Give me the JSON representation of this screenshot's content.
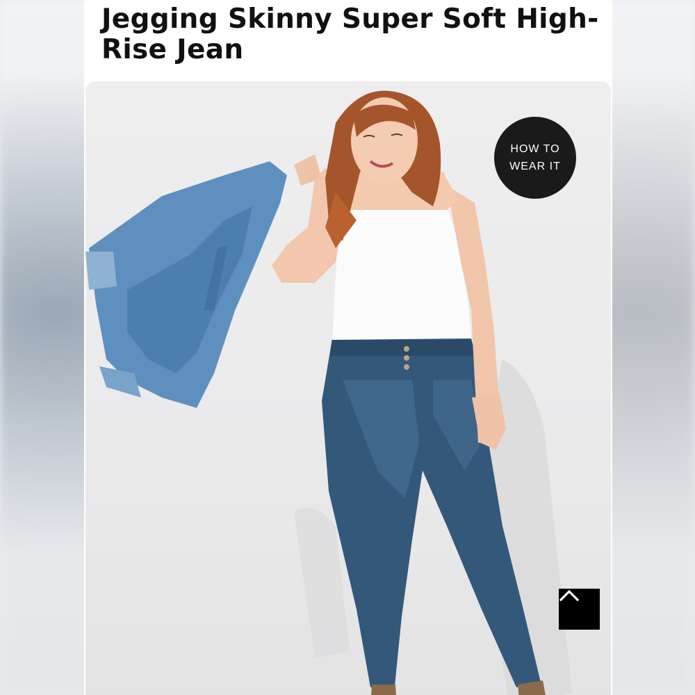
{
  "product": {
    "title": "Jegging Skinny Super Soft High-Rise Jean"
  },
  "badge": {
    "line1": "HOW TO",
    "line2": "WEAR IT"
  },
  "icons": {
    "back_to_top": "chevron-up-icon"
  },
  "colors": {
    "page_bg": "#ffffff",
    "badge_bg": "#1a1a1a",
    "button_bg": "#000000",
    "title_text": "#111111"
  }
}
